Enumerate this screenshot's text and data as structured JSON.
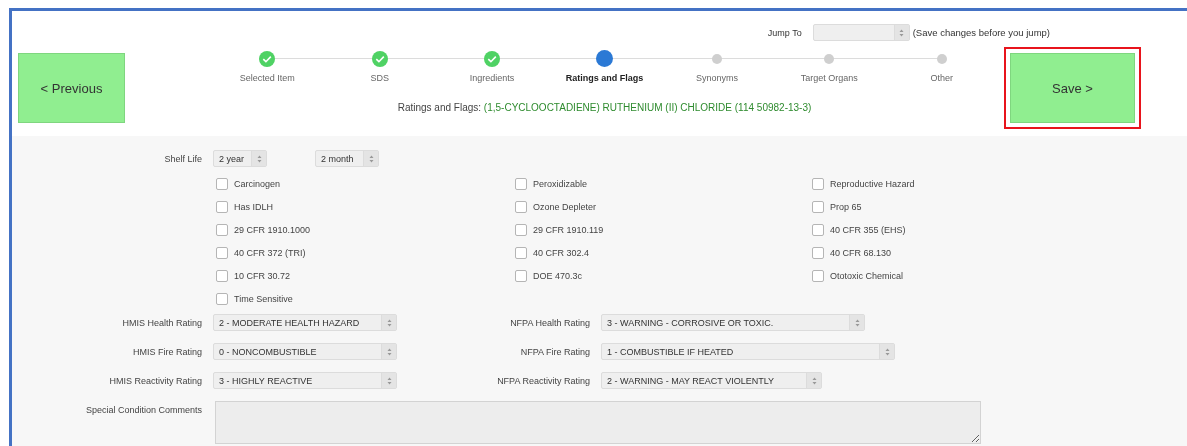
{
  "nav": {
    "previous": "< Previous",
    "save": "Save >",
    "save_highlighted": true
  },
  "jump": {
    "label": "Jump To",
    "hint": "(Save changes before you jump)"
  },
  "steps": [
    {
      "label": "Selected Item",
      "completed": true,
      "selected": false
    },
    {
      "label": "SDS",
      "completed": true,
      "selected": false
    },
    {
      "label": "Ingredients",
      "completed": true,
      "selected": false
    },
    {
      "label": "Ratings and Flags",
      "completed": false,
      "selected": true
    },
    {
      "label": "Synonyms",
      "completed": false,
      "selected": false
    },
    {
      "label": "Target Organs",
      "completed": false,
      "selected": false
    },
    {
      "label": "Other",
      "completed": false,
      "selected": false
    }
  ],
  "subtitle": {
    "label": "Ratings and Flags:",
    "item": "(1,5-CYCLOOCTADIENE) RUTHENIUM (II) CHLORIDE (114 50982-13-3)"
  },
  "shelf_life": {
    "label": "Shelf Life",
    "years": "2 year",
    "months": "2 month"
  },
  "flags": [
    {
      "label": "Carcinogen",
      "checked": false
    },
    {
      "label": "Peroxidizable",
      "checked": false
    },
    {
      "label": "Reproductive Hazard",
      "checked": false
    },
    {
      "label": "Has IDLH",
      "checked": false
    },
    {
      "label": "Ozone Depleter",
      "checked": false
    },
    {
      "label": "Prop 65",
      "checked": false
    },
    {
      "label": "29 CFR 1910.1000",
      "checked": false
    },
    {
      "label": "29 CFR 1910.119",
      "checked": false
    },
    {
      "label": "40 CFR 355 (EHS)",
      "checked": false
    },
    {
      "label": "40 CFR 372 (TRI)",
      "checked": false
    },
    {
      "label": "40 CFR 302.4",
      "checked": false
    },
    {
      "label": "40 CFR 68.130",
      "checked": false
    },
    {
      "label": "10 CFR 30.72",
      "checked": false
    },
    {
      "label": "DOE 470.3c",
      "checked": false
    },
    {
      "label": "Ototoxic Chemical",
      "checked": false
    },
    {
      "label": "Time Sensitive",
      "checked": false
    }
  ],
  "ratings": [
    {
      "label": "HMIS Health Rating",
      "value": "2 - MODERATE HEALTH HAZARD"
    },
    {
      "label": "NFPA Health Rating",
      "value": "3 - WARNING - CORROSIVE OR TOXIC."
    },
    {
      "label": "HMIS Fire Rating",
      "value": "0 - NONCOMBUSTIBLE"
    },
    {
      "label": "NFPA Fire Rating",
      "value": "1 - COMBUSTIBLE IF HEATED"
    },
    {
      "label": "HMIS Reactivity Rating",
      "value": "3 - HIGHLY REACTIVE"
    },
    {
      "label": "NFPA Reactivity Rating",
      "value": "2 - WARNING - MAY REACT VIOLENTLY"
    }
  ],
  "comments": {
    "label": "Special Condition Comments"
  }
}
